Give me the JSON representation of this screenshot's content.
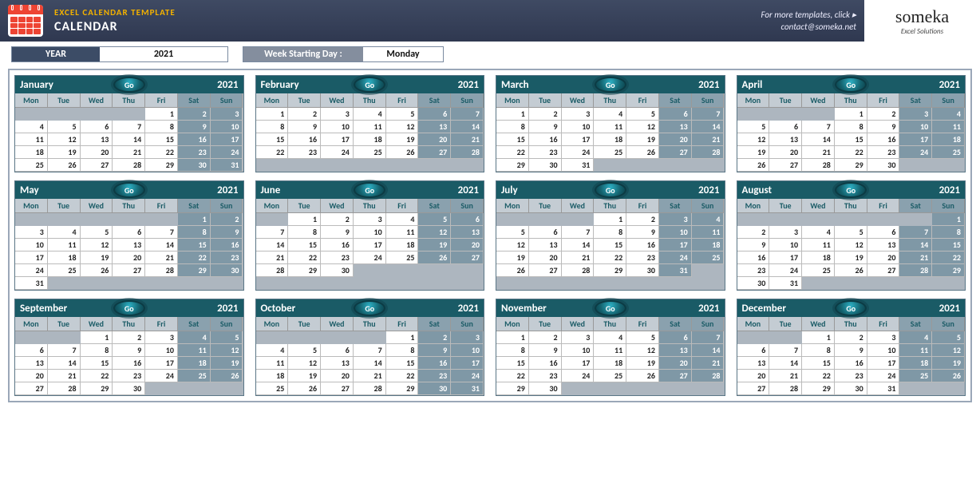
{
  "header": {
    "title_small": "EXCEL CALENDAR TEMPLATE",
    "title_big": "CALENDAR",
    "more_templates": "For more templates, click ▸",
    "contact": "contact@someka.net",
    "brand": "someka",
    "brand_sub": "Excel Solutions"
  },
  "controls": {
    "year_label": "YEAR",
    "year_value": "2021",
    "wsd_label": "Week Starting Day :",
    "wsd_value": "Monday"
  },
  "dow": [
    "Mon",
    "Tue",
    "Wed",
    "Thu",
    "Fri",
    "Sat",
    "Sun"
  ],
  "go_label": "Go",
  "year": "2021",
  "months": [
    {
      "name": "January",
      "start": 4,
      "ndays": 31,
      "rows": 5
    },
    {
      "name": "February",
      "start": 0,
      "ndays": 28,
      "rows": 4
    },
    {
      "name": "March",
      "start": 0,
      "ndays": 31,
      "rows": 5
    },
    {
      "name": "April",
      "start": 3,
      "ndays": 30,
      "rows": 5
    },
    {
      "name": "May",
      "start": 5,
      "ndays": 31,
      "rows": 6
    },
    {
      "name": "June",
      "start": 1,
      "ndays": 30,
      "rows": 5
    },
    {
      "name": "July",
      "start": 3,
      "ndays": 31,
      "rows": 5
    },
    {
      "name": "August",
      "start": 6,
      "ndays": 31,
      "rows": 6
    },
    {
      "name": "September",
      "start": 2,
      "ndays": 30,
      "rows": 5
    },
    {
      "name": "October",
      "start": 4,
      "ndays": 31,
      "rows": 5
    },
    {
      "name": "November",
      "start": 0,
      "ndays": 30,
      "rows": 5
    },
    {
      "name": "December",
      "start": 2,
      "ndays": 31,
      "rows": 5
    }
  ]
}
